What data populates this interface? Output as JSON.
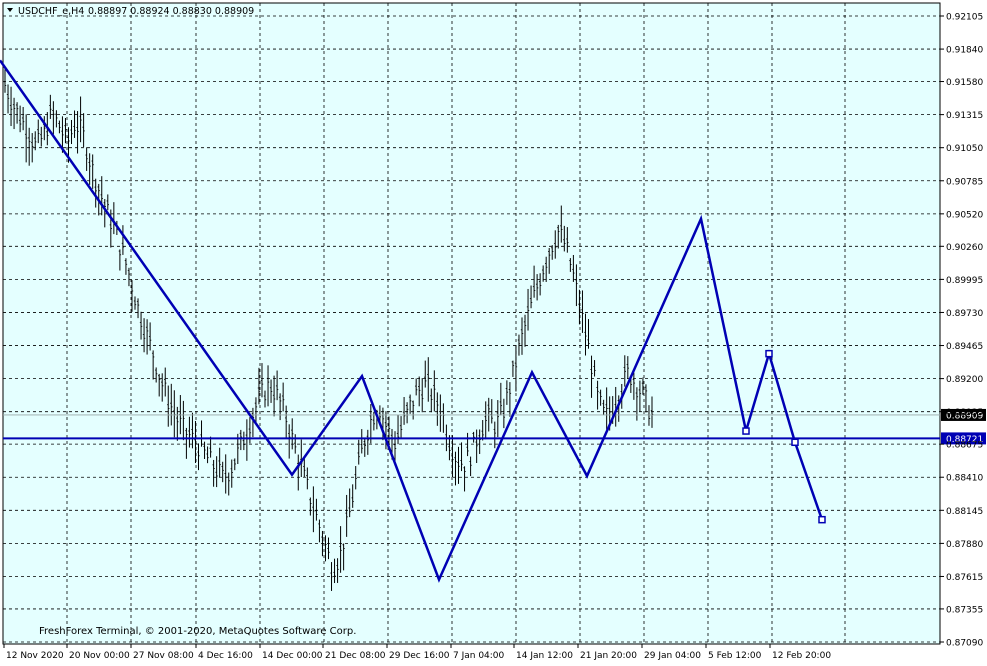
{
  "chart_data": {
    "type": "line",
    "symbol_header": "USDCHF_e,H4",
    "ohlc_header": "0.88897 0.88924 0.88830 0.88909",
    "copyright": "FreshForex Terminal, © 2001-2020, MetaQuotes Software Corp.",
    "y_ticks": [
      "0.92105",
      "0.91840",
      "0.91580",
      "0.91315",
      "0.91050",
      "0.90785",
      "0.90520",
      "0.90260",
      "0.89995",
      "0.89730",
      "0.89465",
      "0.89200",
      "0.88935",
      "0.88675",
      "0.88410",
      "0.88145",
      "0.87880",
      "0.87615",
      "0.87355",
      "0.87090"
    ],
    "ylim": [
      0.8709,
      0.92105
    ],
    "x_labels": [
      "12 Nov 2020",
      "20 Nov 00:00",
      "27 Nov 08:00",
      "4 Dec 16:00",
      "14 Dec 00:00",
      "21 Dec 08:00",
      "29 Dec 16:00",
      "7 Jan 04:00",
      "14 Jan 12:00",
      "21 Jan 20:00",
      "29 Jan 04:00",
      "5 Feb 12:00",
      "12 Feb 20:00"
    ],
    "current_price": {
      "value": 0.88909,
      "label": "0.88909"
    },
    "horizontal_line": {
      "value": 0.88721,
      "label": "0.88721"
    },
    "price_series": {
      "name": "",
      "values": [
        0.9155,
        0.914,
        0.9128,
        0.9118,
        0.9105,
        0.9115,
        0.9132,
        0.9122,
        0.9108,
        0.9125,
        0.9116,
        0.9092,
        0.9072,
        0.9055,
        0.904,
        0.9022,
        0.9002,
        0.8978,
        0.8958,
        0.894,
        0.8918,
        0.8902,
        0.8888,
        0.8878,
        0.8872,
        0.8865,
        0.8856,
        0.8848,
        0.884,
        0.8848,
        0.8862,
        0.8878,
        0.8895,
        0.8908,
        0.8915,
        0.8905,
        0.889,
        0.8868,
        0.8848,
        0.8828,
        0.8808,
        0.8788,
        0.8768,
        0.8778,
        0.8805,
        0.8838,
        0.8868,
        0.8888,
        0.8898,
        0.888,
        0.8868,
        0.8882,
        0.8898,
        0.891,
        0.8915,
        0.8905,
        0.8895,
        0.887,
        0.8855,
        0.8852,
        0.8862,
        0.888,
        0.8888,
        0.8882,
        0.8895,
        0.8918,
        0.8945,
        0.8968,
        0.8988,
        0.9008,
        0.9025,
        0.9038,
        0.9025,
        0.9,
        0.897,
        0.894,
        0.8905,
        0.8888,
        0.8898,
        0.8912,
        0.8925,
        0.8915,
        0.8905,
        0.889
      ]
    },
    "zigzag": {
      "name": "",
      "points": [
        [
          0,
          0.9175
        ],
        [
          292,
          0.8843
        ],
        [
          362,
          0.8922
        ],
        [
          439,
          0.8759
        ],
        [
          532,
          0.8925
        ],
        [
          587,
          0.8842
        ],
        [
          701,
          0.9048
        ],
        [
          746,
          0.8878
        ],
        [
          769,
          0.894
        ],
        [
          795,
          0.8869
        ],
        [
          822,
          0.8807
        ]
      ],
      "color": "#0000b4"
    },
    "colors": {
      "plot_bg": "#e4ffff",
      "grid": "#000000",
      "bars": "#000000",
      "zigzag": "#0000b4",
      "hline": "#0000b4",
      "price_label_bg": "#000000",
      "price_label_text": "#ffffff"
    },
    "grid": true
  }
}
